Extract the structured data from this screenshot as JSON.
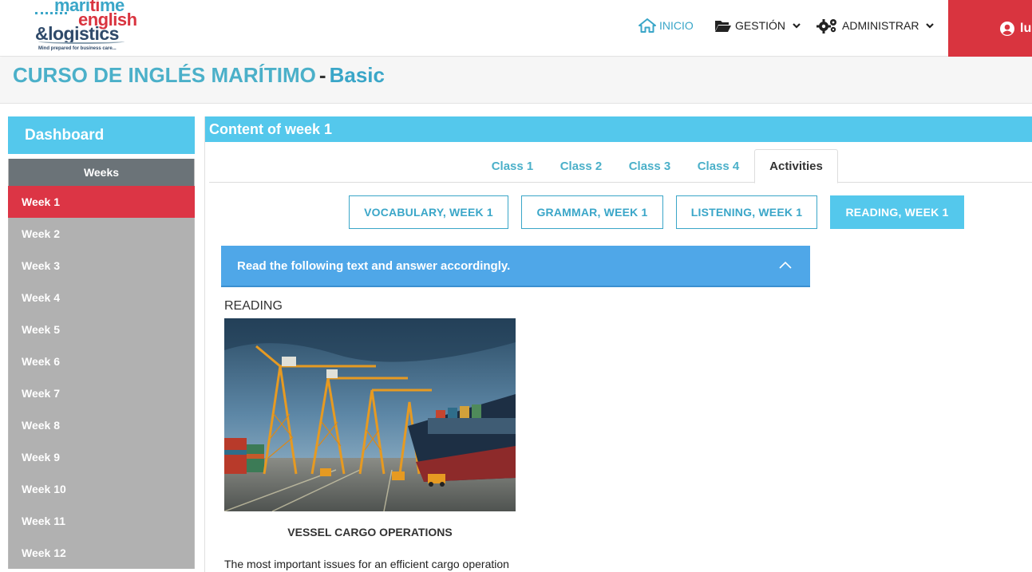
{
  "logo": {
    "line1_a": "mari",
    "line1_b": "ti",
    "line1_c": "me",
    "line2": "english",
    "line3": "&logistics",
    "tagline": "Mind prepared for business care..."
  },
  "nav": {
    "home": "INICIO",
    "manage": "GESTIÓN",
    "admin": "ADMINISTRAR",
    "user_initial": "lu"
  },
  "page": {
    "title": "CURSO DE INGLÉS MARÍTIMO",
    "separator": "-",
    "level": "Basic"
  },
  "sidebar": {
    "dashboard": "Dashboard",
    "weeks_header": "Weeks",
    "weeks": [
      "Week 1",
      "Week 2",
      "Week 3",
      "Week 4",
      "Week 5",
      "Week 6",
      "Week 7",
      "Week 8",
      "Week 9",
      "Week 10",
      "Week 11",
      "Week 12"
    ],
    "active_week": "Week 1"
  },
  "main": {
    "header": "Content of week 1",
    "tabs": [
      "Class 1",
      "Class 2",
      "Class 3",
      "Class 4",
      "Activities"
    ],
    "active_tab": "Activities",
    "subtabs": [
      "VOCABULARY, WEEK 1",
      "GRAMMAR, WEEK 1",
      "LISTENING, WEEK 1",
      "READING, WEEK 1"
    ],
    "active_subtab": "READING, WEEK 1",
    "accordion_title": "Read the following text and answer accordingly.",
    "section_label": "READING",
    "image_caption": "VESSEL CARGO OPERATIONS",
    "body_text": "The most important issues for an efficient cargo operation"
  },
  "colors": {
    "accent_cyan": "#54c8ec",
    "accent_blue": "#4fa7e8",
    "brand_red": "#dc3545",
    "title_teal": "#4bb0c9"
  }
}
